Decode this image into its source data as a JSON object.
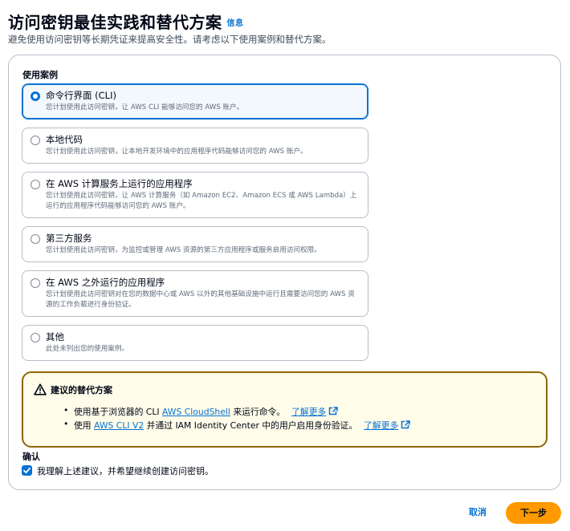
{
  "header": {
    "title": "访问密钥最佳实践和替代方案",
    "info_link": "信息",
    "subtitle": "避免使用访问密钥等长期凭证来提高安全性。请考虑以下使用案例和替代方案。"
  },
  "use_cases": {
    "label": "使用案例",
    "selected_index": 0,
    "options": [
      {
        "title": "命令行界面 (CLI)",
        "description": "您计划使用此访问密钥，让 AWS CLI 能够访问您的 AWS 账户。"
      },
      {
        "title": "本地代码",
        "description": "您计划使用此访问密钥，让本地开发环境中的应用程序代码能够访问您的 AWS 账户。"
      },
      {
        "title": "在 AWS 计算服务上运行的应用程序",
        "description": "您计划使用此访问密钥，让 AWS 计算服务（如 Amazon EC2、Amazon ECS 或 AWS Lambda）上运行的应用程序代码能够访问您的 AWS 账户。"
      },
      {
        "title": "第三方服务",
        "description": "您计划使用此访问密钥，为监控或管理 AWS 资源的第三方应用程序或服务启用访问权限。"
      },
      {
        "title": "在 AWS 之外运行的应用程序",
        "description": "您计划使用此访问密钥对在您的数据中心或 AWS 以外的其他基础设施中运行且需要访问您的 AWS 资源的工作负载进行身份验证。"
      },
      {
        "title": "其他",
        "description": "此处未列出您的使用案例。"
      }
    ]
  },
  "alert": {
    "icon": "warning-icon",
    "title": "建议的替代方案",
    "items": [
      {
        "before": "使用基于浏览器的 CLI ",
        "link": "AWS CloudShell",
        "after": " 来运行命令。",
        "learn_more": "了解更多"
      },
      {
        "before": "使用 ",
        "link": "AWS CLI V2",
        "after": " 并通过 IAM Identity Center 中的用户启用身份验证。",
        "learn_more": "了解更多"
      }
    ]
  },
  "confirmation": {
    "label": "确认",
    "checked": true,
    "checkbox_text": "我理解上述建议，并希望继续创建访问密钥。"
  },
  "footer": {
    "cancel_label": "取消",
    "next_label": "下一步"
  },
  "colors": {
    "accent": "#0972d3",
    "primary_button": "#ff9900",
    "warning_border": "#8d6605",
    "warning_bg": "#fffce9"
  }
}
